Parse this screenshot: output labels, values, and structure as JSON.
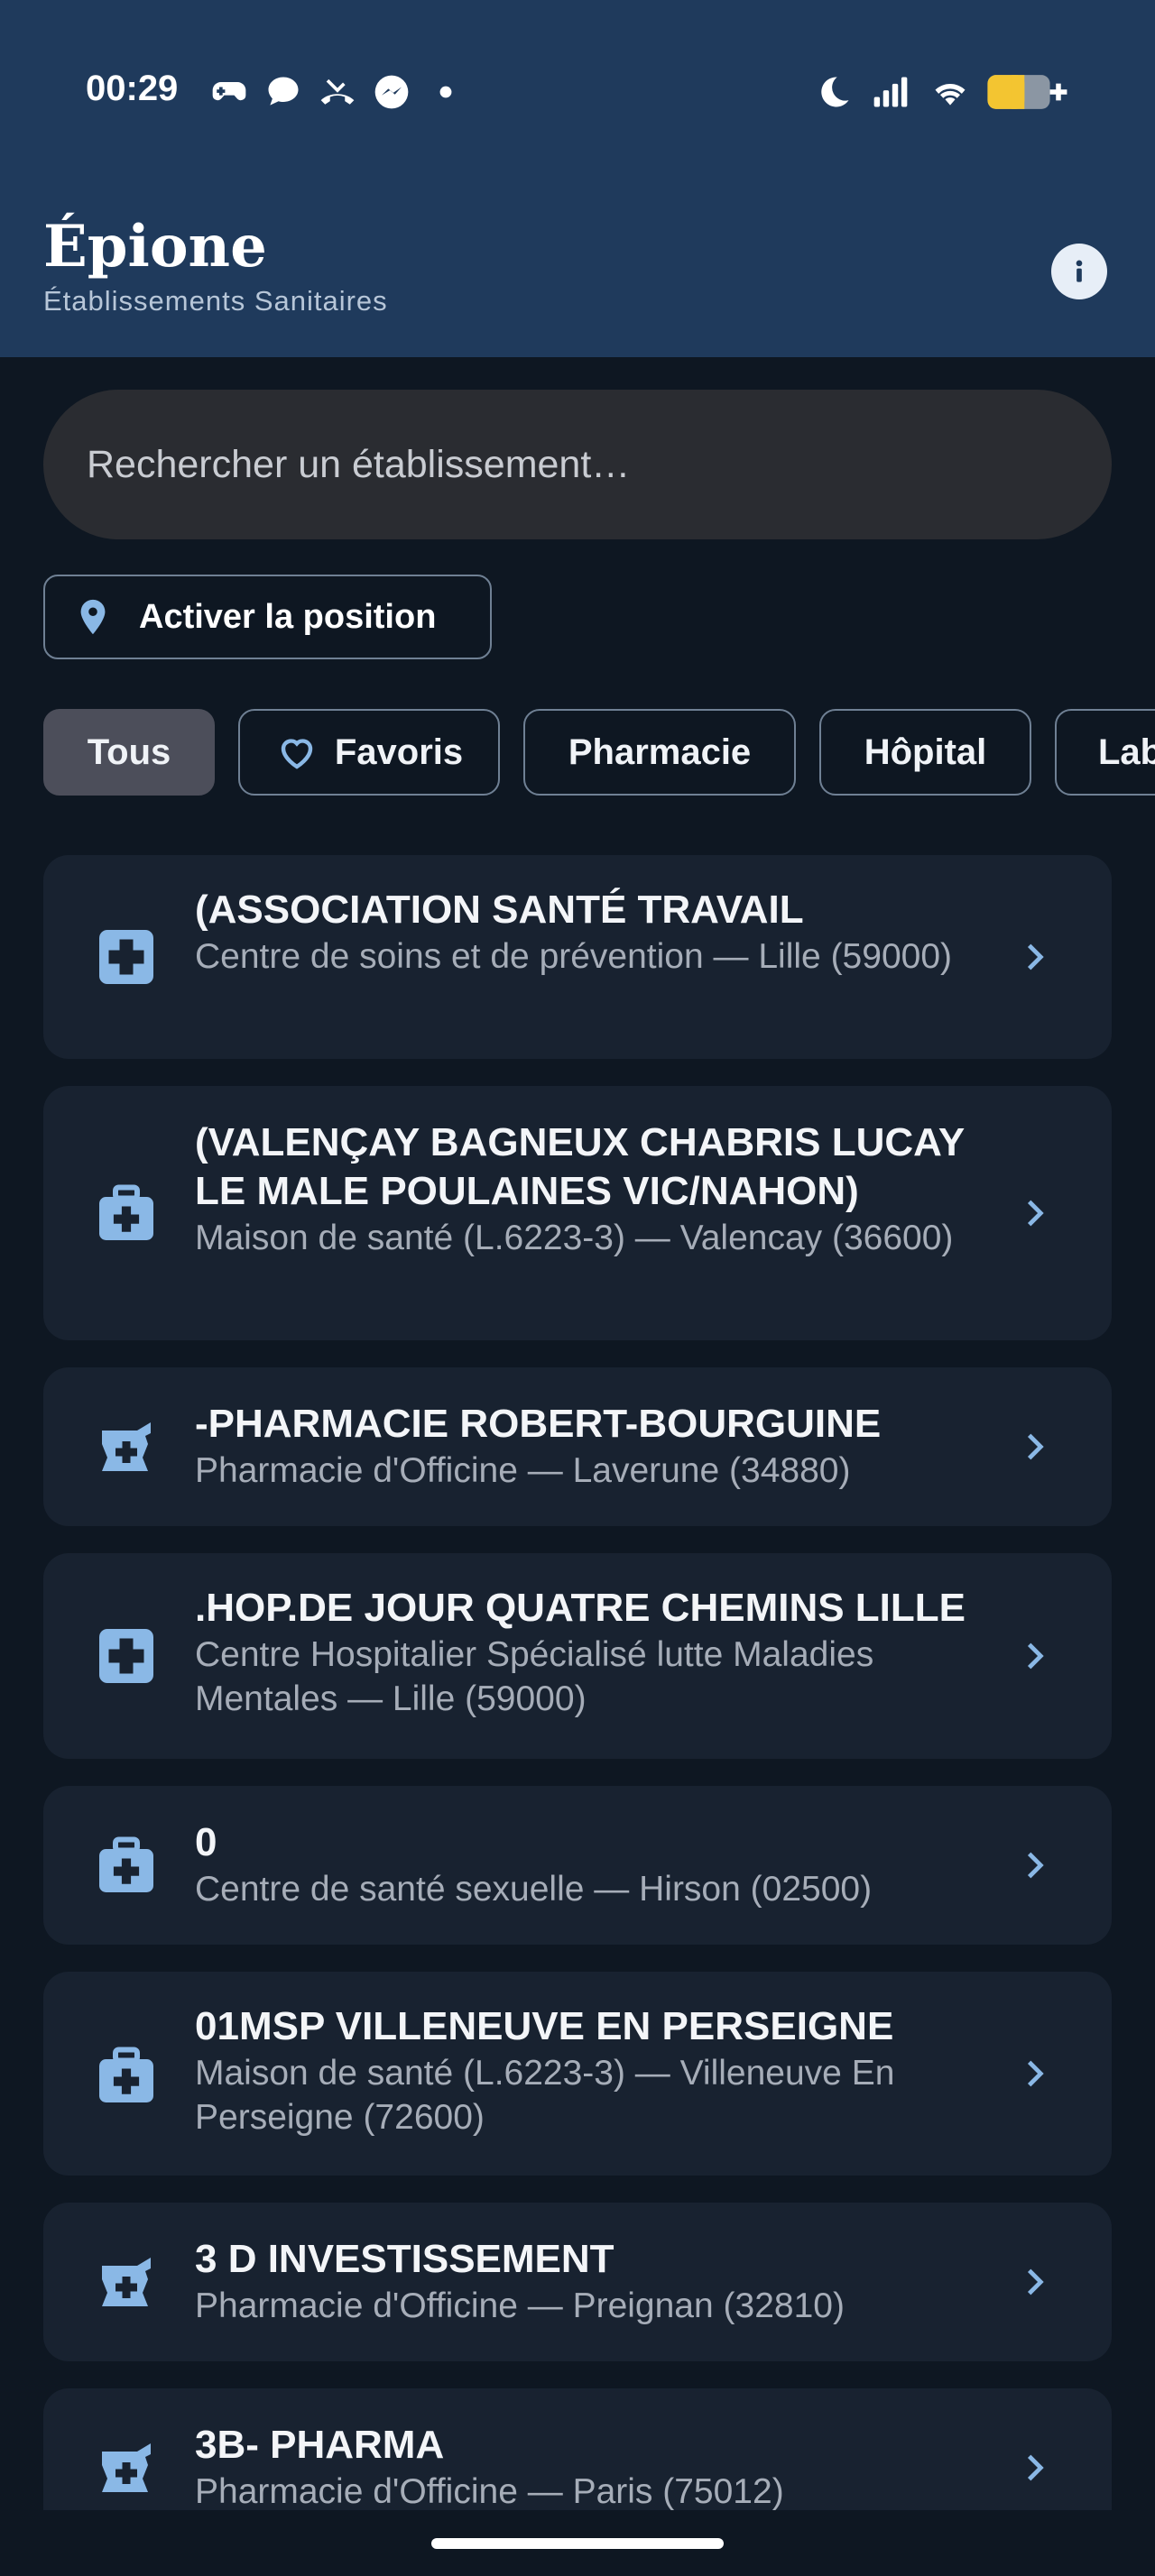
{
  "status_bar": {
    "time": "00:29",
    "app_icons": [
      "gamepad-icon",
      "chat-bubble-icon",
      "phone-missed-icon",
      "messenger-icon",
      "dot-icon"
    ],
    "system_icons": [
      "moon-icon",
      "signal-icon",
      "wifi-icon",
      "battery-icon"
    ]
  },
  "header": {
    "title": "Épione",
    "subtitle": "Établissements Sanitaires",
    "info_icon": "info-icon"
  },
  "search": {
    "placeholder": "Rechercher un établissement…"
  },
  "location_button": {
    "label": "Activer la position",
    "icon": "location-pin-icon"
  },
  "filters": [
    {
      "label": "Tous",
      "active": true
    },
    {
      "label": "Favoris",
      "icon": "heart-icon",
      "active": false
    },
    {
      "label": "Pharmacie",
      "active": false
    },
    {
      "label": "Hôpital",
      "active": false
    },
    {
      "label": "Lab",
      "active": false
    }
  ],
  "establishments": [
    {
      "title": "(ASSOCIATION SANTÉ TRAVAIL",
      "subtitle": "Centre de soins et de prévention — Lille (59000)",
      "icon": "medical-cross-icon"
    },
    {
      "title": "(VALENÇAY BAGNEUX CHABRIS LUCAY LE MALE POULAINES VIC/NAHON)",
      "subtitle": "Maison de santé (L.6223-3) — Valencay (36600)",
      "icon": "medical-bag-icon"
    },
    {
      "title": "-PHARMACIE ROBERT-BOURGUINE",
      "subtitle": "Pharmacie d'Officine — Laverune (34880)",
      "icon": "pharmacy-mortar-icon"
    },
    {
      "title": ".HOP.DE JOUR QUATRE CHEMINS LILLE",
      "subtitle": "Centre Hospitalier Spécialisé lutte Maladies Mentales — Lille (59000)",
      "icon": "medical-cross-icon"
    },
    {
      "title": "0",
      "subtitle": "Centre de santé sexuelle — Hirson (02500)",
      "icon": "medical-bag-icon"
    },
    {
      "title": "01MSP VILLENEUVE EN PERSEIGNE",
      "subtitle": "Maison de santé (L.6223-3) — Villeneuve En Perseigne (72600)",
      "icon": "medical-bag-icon"
    },
    {
      "title": "3 D INVESTISSEMENT",
      "subtitle": "Pharmacie d'Officine — Preignan (32810)",
      "icon": "pharmacy-mortar-icon"
    },
    {
      "title": "3B- PHARMA",
      "subtitle": "Pharmacie d'Officine — Paris (75012)",
      "icon": "pharmacy-mortar-icon"
    }
  ],
  "colors": {
    "header_bg": "#1f3a5c",
    "page_bg": "#0e1722",
    "card_bg": "#182230",
    "accent": "#7fb2e5"
  }
}
